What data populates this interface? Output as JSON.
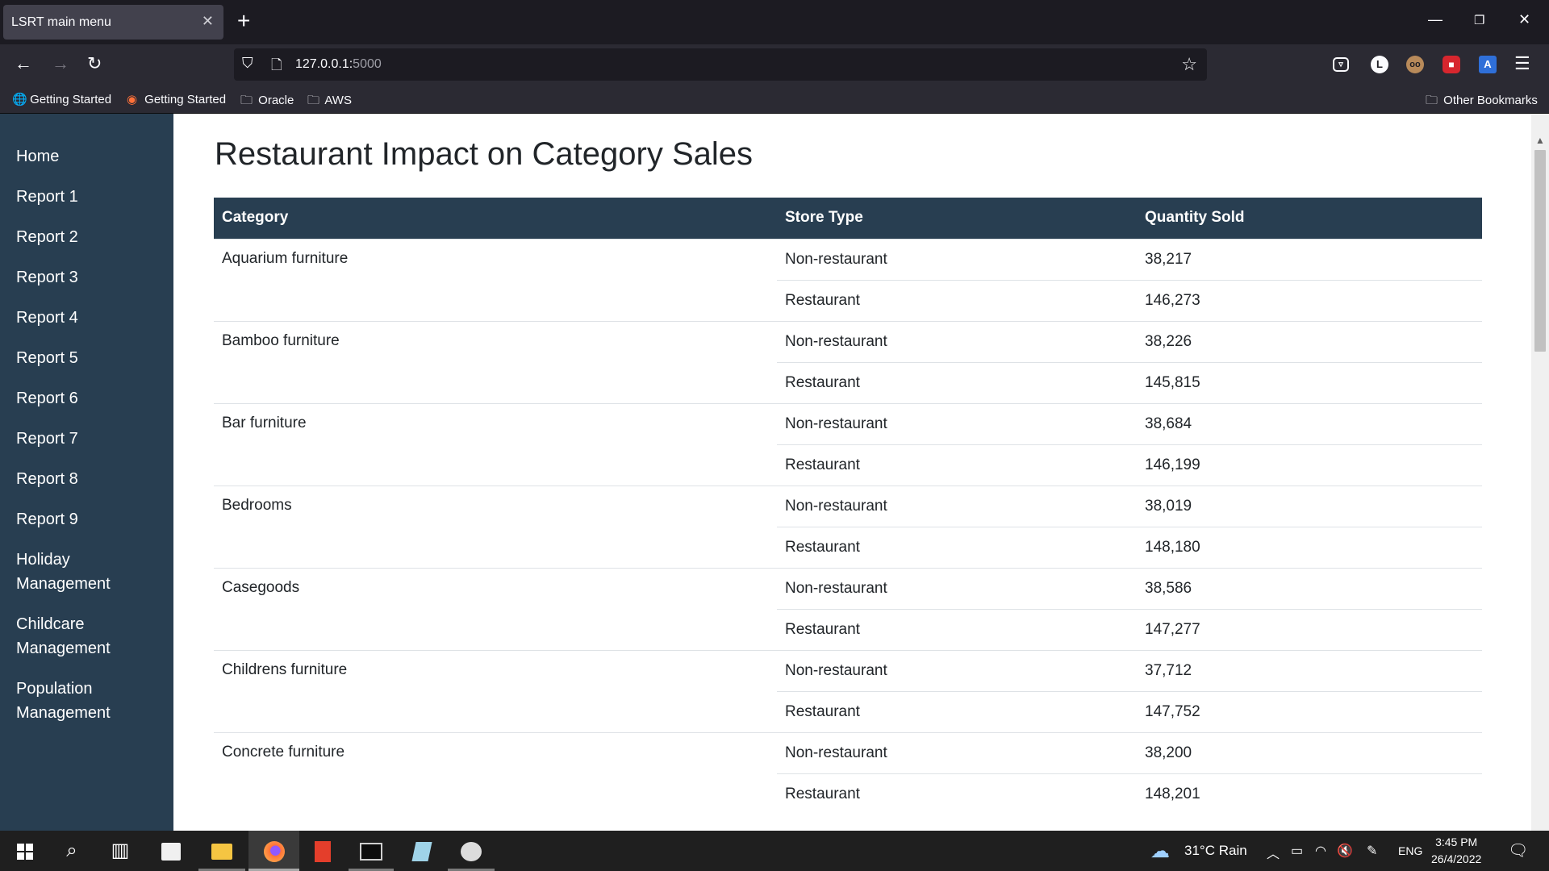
{
  "browser": {
    "tab_title": "LSRT main menu",
    "tab_close_icon": "close-icon",
    "new_tab_label": "+",
    "url_host": "127.0.0.1:",
    "url_port": "5000",
    "bookmarks": [
      {
        "label": "Getting Started",
        "icon": "globe-icon"
      },
      {
        "label": "Getting Started",
        "icon": "firefox-icon"
      },
      {
        "label": "Oracle",
        "icon": "folder-icon"
      },
      {
        "label": "AWS",
        "icon": "folder-icon"
      }
    ],
    "other_bookmarks": "Other Bookmarks",
    "extensions": [
      {
        "name": "pocket-icon",
        "glyph": "◘"
      },
      {
        "name": "profile-icon",
        "glyph": "L"
      },
      {
        "name": "extension-eyes-icon",
        "glyph": "👀"
      },
      {
        "name": "lock-extension-icon",
        "glyph": "🔒"
      },
      {
        "name": "translate-icon",
        "glyph": "A"
      }
    ]
  },
  "sidebar": {
    "items": [
      {
        "label": "Home"
      },
      {
        "label": "Report 1"
      },
      {
        "label": "Report 2"
      },
      {
        "label": "Report 3"
      },
      {
        "label": "Report 4"
      },
      {
        "label": "Report 5"
      },
      {
        "label": "Report 6"
      },
      {
        "label": "Report 7"
      },
      {
        "label": "Report 8"
      },
      {
        "label": "Report 9"
      },
      {
        "label": "Holiday Management"
      },
      {
        "label": "Childcare Management"
      },
      {
        "label": "Population Management"
      }
    ]
  },
  "main": {
    "title": "Restaurant Impact on Category Sales",
    "table": {
      "headers": [
        "Category",
        "Store Type",
        "Quantity Sold"
      ],
      "groups": [
        {
          "category": "Aquarium furniture",
          "rows": [
            [
              "Non-restaurant",
              "38,217"
            ],
            [
              "Restaurant",
              "146,273"
            ]
          ]
        },
        {
          "category": "Bamboo furniture",
          "rows": [
            [
              "Non-restaurant",
              "38,226"
            ],
            [
              "Restaurant",
              "145,815"
            ]
          ]
        },
        {
          "category": "Bar furniture",
          "rows": [
            [
              "Non-restaurant",
              "38,684"
            ],
            [
              "Restaurant",
              "146,199"
            ]
          ]
        },
        {
          "category": "Bedrooms",
          "rows": [
            [
              "Non-restaurant",
              "38,019"
            ],
            [
              "Restaurant",
              "148,180"
            ]
          ]
        },
        {
          "category": "Casegoods",
          "rows": [
            [
              "Non-restaurant",
              "38,586"
            ],
            [
              "Restaurant",
              "147,277"
            ]
          ]
        },
        {
          "category": "Childrens furniture",
          "rows": [
            [
              "Non-restaurant",
              "37,712"
            ],
            [
              "Restaurant",
              "147,752"
            ]
          ]
        },
        {
          "category": "Concrete furniture",
          "rows": [
            [
              "Non-restaurant",
              "38,200"
            ],
            [
              "Restaurant",
              "148,201"
            ]
          ]
        }
      ]
    }
  },
  "taskbar": {
    "apps": [
      {
        "name": "start-button",
        "glyph": "⊞"
      },
      {
        "name": "search-button",
        "glyph": "⌕"
      },
      {
        "name": "task-view-button",
        "glyph": "▤"
      },
      {
        "name": "store-app",
        "glyph": "▦"
      },
      {
        "name": "file-explorer-app",
        "glyph": "▬"
      },
      {
        "name": "firefox-app",
        "glyph": "◉"
      },
      {
        "name": "office-app",
        "glyph": "▮"
      },
      {
        "name": "terminal-app",
        "glyph": "▭"
      },
      {
        "name": "notepad-app",
        "glyph": "◆"
      },
      {
        "name": "paint-app",
        "glyph": "◐"
      }
    ],
    "weather": "31°C  Rain",
    "language": "ENG",
    "time": "3:45 PM",
    "date": "26/4/2022"
  },
  "colors": {
    "sidebar_bg": "#283e51",
    "header_bg": "#283e51"
  }
}
